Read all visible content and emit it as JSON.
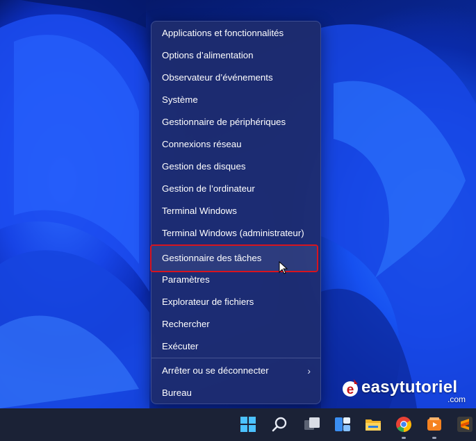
{
  "context_menu": {
    "items": [
      {
        "label": "Applications et fonctionnalités"
      },
      {
        "label": "Options d’alimentation"
      },
      {
        "label": "Observateur d’événements"
      },
      {
        "label": "Système"
      },
      {
        "label": "Gestionnaire de périphériques"
      },
      {
        "label": "Connexions réseau"
      },
      {
        "label": "Gestion des disques"
      },
      {
        "label": "Gestion de l’ordinateur"
      },
      {
        "label": "Terminal Windows"
      },
      {
        "label": "Terminal Windows (administrateur)"
      },
      {
        "label": "Gestionnaire des tâches",
        "highlighted": true
      },
      {
        "label": "Paramètres"
      },
      {
        "label": "Explorateur de fichiers"
      },
      {
        "label": "Rechercher"
      },
      {
        "label": "Exécuter"
      },
      {
        "label": "Arrêter ou se déconnecter",
        "has_submenu": true
      },
      {
        "label": "Bureau"
      }
    ],
    "highlight_color": "#d8141e"
  },
  "watermark": {
    "brand": "easytutoriel",
    "domain": ".com"
  },
  "taskbar": {
    "icons": [
      "windows-start-icon",
      "search-icon",
      "task-view-icon",
      "widgets-icon",
      "file-explorer-icon",
      "chrome-icon",
      "media-player-icon",
      "sublime-text-icon"
    ]
  }
}
